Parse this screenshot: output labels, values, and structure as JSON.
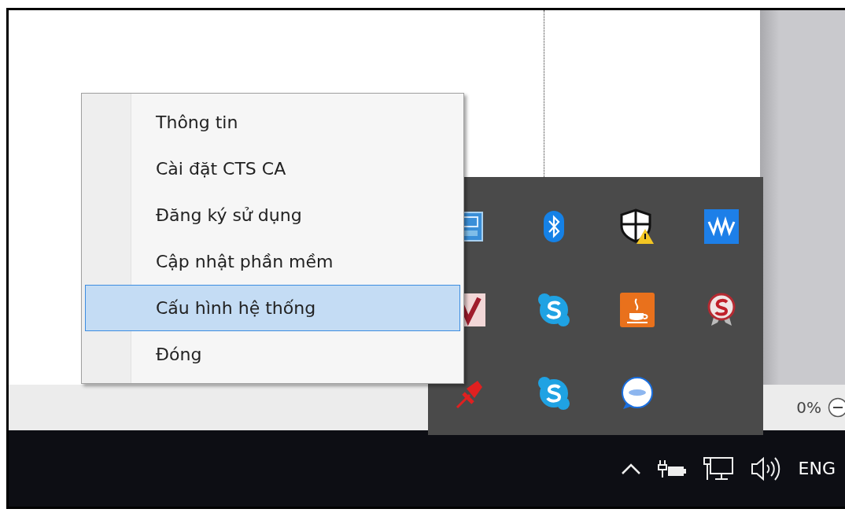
{
  "context_menu": {
    "items": [
      {
        "label": "Thông tin",
        "selected": false
      },
      {
        "label": "Cài đặt CTS CA",
        "selected": false
      },
      {
        "label": "Đăng ký sử dụng",
        "selected": false
      },
      {
        "label": "Cập nhật phần mềm",
        "selected": false
      },
      {
        "label": "Cấu hình hệ thống",
        "selected": true
      },
      {
        "label": "Đóng",
        "selected": false
      }
    ]
  },
  "tray_overflow": {
    "icons": [
      {
        "kind": "app"
      },
      {
        "kind": "bluetooth"
      },
      {
        "kind": "shield"
      },
      {
        "kind": "wave"
      },
      {
        "kind": "check"
      },
      {
        "kind": "chat"
      },
      {
        "kind": "cup"
      },
      {
        "kind": "badge"
      },
      {
        "kind": "pin"
      },
      {
        "kind": "chat"
      },
      {
        "kind": "bubble"
      }
    ]
  },
  "status_bar": {
    "zoom": "0%"
  },
  "taskbar": {
    "language": "ENG"
  }
}
